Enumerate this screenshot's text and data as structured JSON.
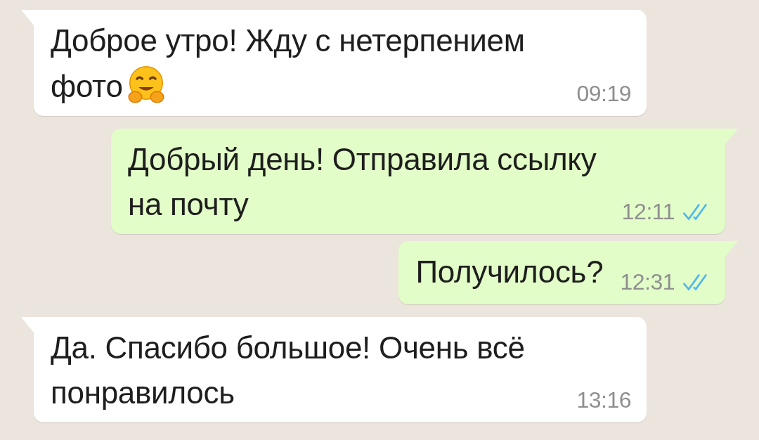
{
  "messages": [
    {
      "kind": "incoming",
      "lines": [
        "Доброе утро! Жду с нетерпением",
        "фото"
      ],
      "has_emoji": true,
      "time": "09:19"
    },
    {
      "kind": "outgoing",
      "lines": [
        "Добрый день! Отправила ссылку",
        "на почту"
      ],
      "has_emoji": false,
      "time": "12:11",
      "read": true
    },
    {
      "kind": "outgoing",
      "lines": [
        "Получилось?"
      ],
      "has_emoji": false,
      "time": "12:31",
      "read": true
    },
    {
      "kind": "incoming",
      "lines": [
        "Да. Спасибо большое! Очень всё",
        "понравилось"
      ],
      "has_emoji": false,
      "time": "13:16"
    }
  ]
}
